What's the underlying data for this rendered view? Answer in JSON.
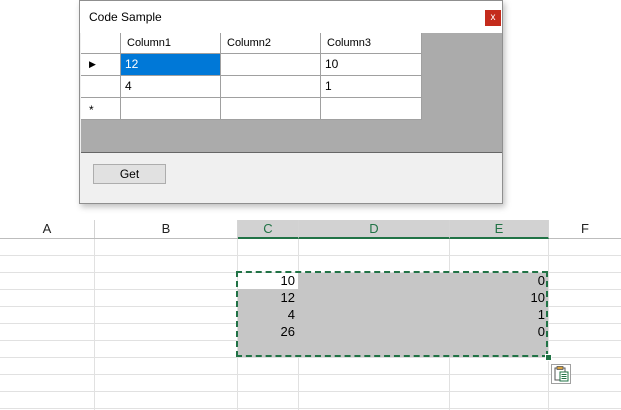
{
  "dialog": {
    "title": "Code Sample",
    "close_glyph": "x",
    "get_button": "Get",
    "grid": {
      "columns": [
        "Column1",
        "Column2",
        "Column3"
      ],
      "rows": [
        {
          "marker": "▶",
          "cells": [
            "12",
            "",
            "10"
          ]
        },
        {
          "marker": "",
          "cells": [
            "4",
            "",
            "1"
          ]
        },
        {
          "marker": "*",
          "cells": [
            "",
            "",
            ""
          ]
        }
      ]
    }
  },
  "sheet": {
    "columns": [
      "A",
      "B",
      "C",
      "D",
      "E",
      "F"
    ],
    "selected_columns": [
      "C",
      "D",
      "E"
    ],
    "rows": [
      {
        "C": "10",
        "E": "0"
      },
      {
        "C": "12",
        "E": "10"
      },
      {
        "C": "4",
        "E": "1"
      },
      {
        "C": "26",
        "E": "0"
      }
    ],
    "accent_color": "#217346",
    "paste_options_icon": "paste-options-icon"
  }
}
